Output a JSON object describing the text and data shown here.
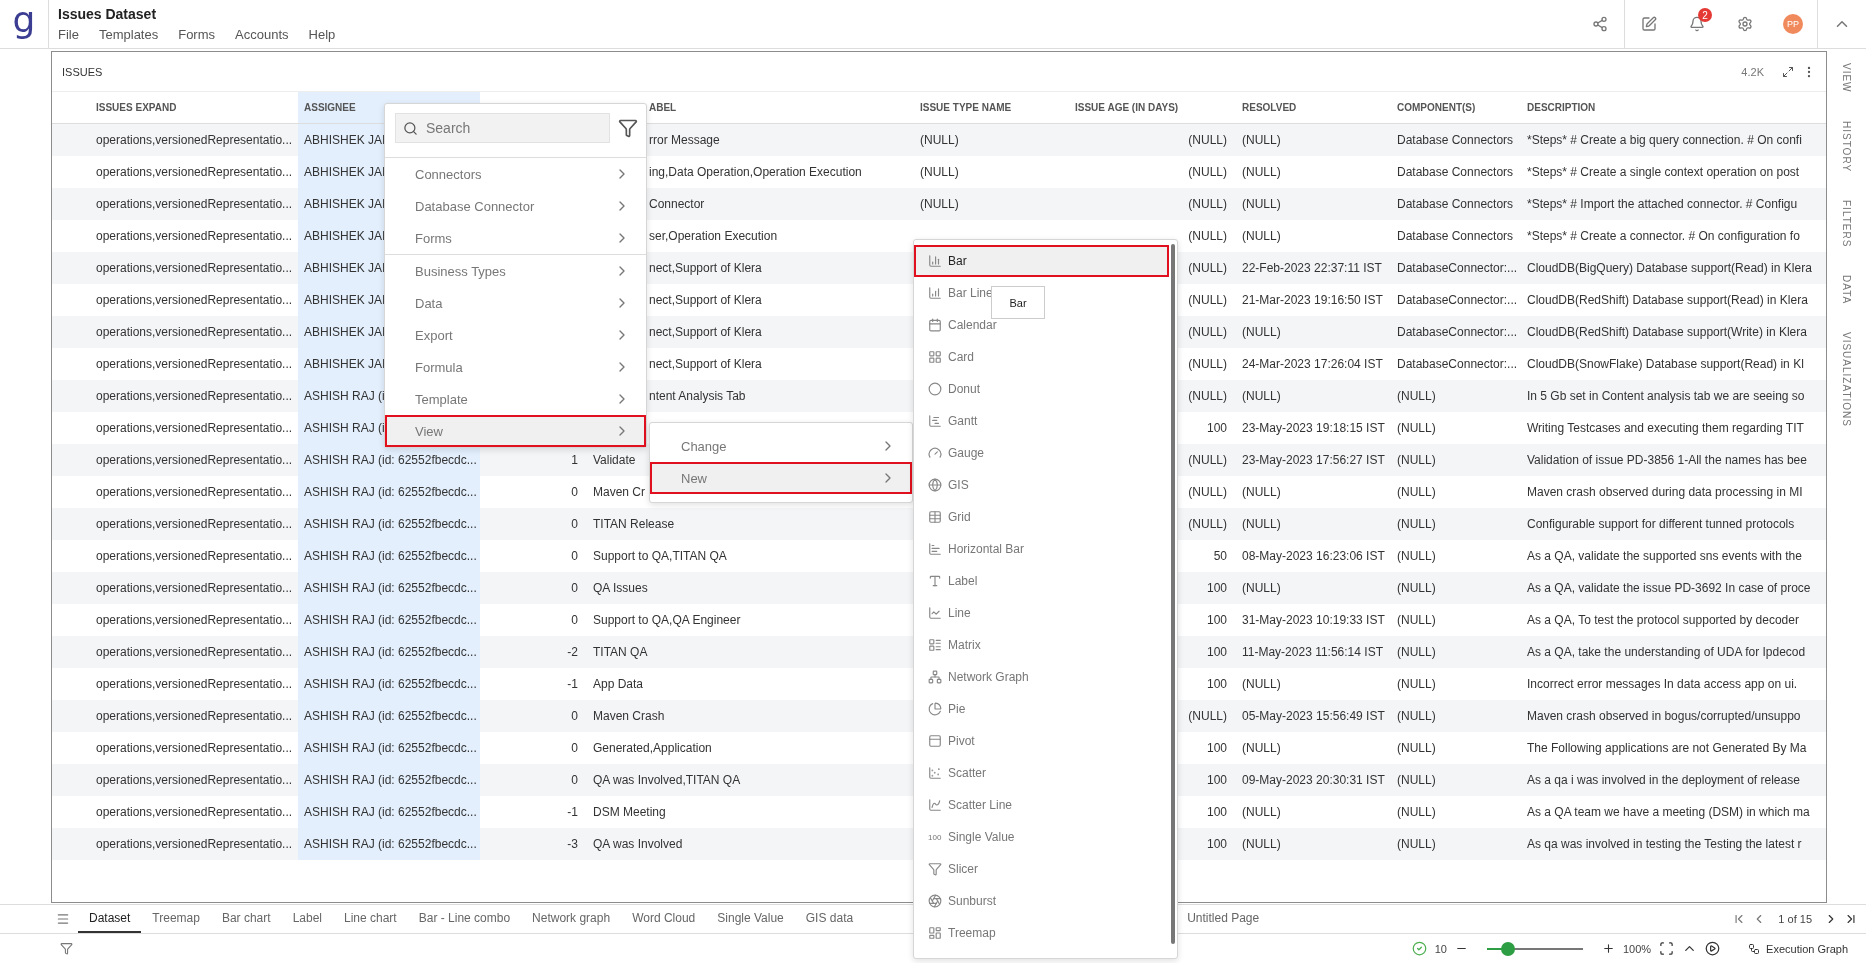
{
  "app": {
    "logo": "g",
    "title": "Issues Dataset",
    "menu": [
      "File",
      "Templates",
      "Forms",
      "Accounts",
      "Help"
    ],
    "notifications": "2",
    "avatar": "PP"
  },
  "panel": {
    "title": "ISSUES",
    "count": "4.2K"
  },
  "table": {
    "columns": [
      {
        "label": "ISSUES EXPAND"
      },
      {
        "label": "ASSIGNEE"
      },
      {
        "label_tail": "ABEL"
      },
      {
        "label": "ISSUE TYPE NAME"
      },
      {
        "label": "ISSUE AGE (IN DAYS)"
      },
      {
        "label": "RESOLVED"
      },
      {
        "label": "COMPONENT(S)"
      },
      {
        "label": "DESCRIPTION"
      }
    ],
    "rows": [
      {
        "issues_expand": "operations,versionedRepresentatio...",
        "assignee": "ABHISHEK JAI",
        "label_tail": "rror Message",
        "issue_type": "(NULL)",
        "age": "(NULL)",
        "resolved": "(NULL)",
        "components": "Database Connectors",
        "description": "*Steps* # Create a big query connection. # On confi"
      },
      {
        "issues_expand": "operations,versionedRepresentatio...",
        "assignee": "ABHISHEK JAI",
        "label_tail": "ing,Data Operation,Operation Execution",
        "issue_type": "(NULL)",
        "age": "(NULL)",
        "resolved": "(NULL)",
        "components": "Database Connectors",
        "description": "*Steps* # Create a single context operation on post"
      },
      {
        "issues_expand": "operations,versionedRepresentatio...",
        "assignee": "ABHISHEK JAI",
        "label_tail": "Connector",
        "issue_type": "(NULL)",
        "age": "(NULL)",
        "resolved": "(NULL)",
        "components": "Database Connectors",
        "description": "*Steps* # Import the attached connector. # Configu"
      },
      {
        "issues_expand": "operations,versionedRepresentatio...",
        "assignee": "ABHISHEK JAI",
        "label_tail": "ser,Operation Execution",
        "age": "(NULL)",
        "resolved": "(NULL)",
        "components": "Database Connectors",
        "description": "*Steps* # Create a connector. # On configuration fo"
      },
      {
        "issues_expand": "operations,versionedRepresentatio...",
        "assignee": "ABHISHEK JAI",
        "label_tail": "nect,Support of Klera",
        "age": "(NULL)",
        "resolved": "22-Feb-2023 22:37:11 IST",
        "components": "DatabaseConnector:...",
        "description": "CloudDB(BigQuery) Database support(Read) in Klera"
      },
      {
        "issues_expand": "operations,versionedRepresentatio...",
        "assignee": "ABHISHEK JAI",
        "label_tail": "nect,Support of Klera",
        "age": "(NULL)",
        "resolved": "21-Mar-2023 19:16:50 IST",
        "components": "DatabaseConnector:...",
        "description": "CloudDB(RedShift) Database support(Read) in Klera"
      },
      {
        "issues_expand": "operations,versionedRepresentatio...",
        "assignee": "ABHISHEK JAI",
        "label_tail": "nect,Support of Klera",
        "age": "(NULL)",
        "resolved": "(NULL)",
        "components": "DatabaseConnector:...",
        "description": "CloudDB(RedShift) Database support(Write) in Klera"
      },
      {
        "issues_expand": "operations,versionedRepresentatio...",
        "assignee": "ABHISHEK JAI",
        "label_tail": "nect,Support of Klera",
        "age": "(NULL)",
        "resolved": "24-Mar-2023 17:26:04 IST",
        "components": "DatabaseConnector:...",
        "description": "CloudDB(SnowFlake) Database support(Read) in Kl"
      },
      {
        "issues_expand": "operations,versionedRepresentatio...",
        "assignee": "ASHISH RAJ (i",
        "label_tail": "ntent Analysis Tab",
        "age": "(NULL)",
        "resolved": "(NULL)",
        "components": "(NULL)",
        "description": "In 5 Gb set in Content analysis tab we are seeing so"
      },
      {
        "issues_expand": "operations,versionedRepresentatio...",
        "assignee": "ASHISH RAJ (i",
        "age": "100",
        "resolved": "23-May-2023 19:18:15 IST",
        "components": "(NULL)",
        "description": "Writing Testcases and executing them regarding TIT"
      },
      {
        "issues_expand": "operations,versionedRepresentatio...",
        "assignee": "ASHISH RAJ (id: 62552fbecdc...",
        "number": "1",
        "label": "Validate",
        "age": "(NULL)",
        "resolved": "23-May-2023 17:56:27 IST",
        "components": "(NULL)",
        "description": "Validation of issue PD-3856 1-All the names has bee"
      },
      {
        "issues_expand": "operations,versionedRepresentatio...",
        "assignee": "ASHISH RAJ (id: 62552fbecdc...",
        "number": "0",
        "label": "Maven Cr",
        "age": "(NULL)",
        "resolved": "(NULL)",
        "components": "(NULL)",
        "description": "Maven crash observed during data processing in MI"
      },
      {
        "issues_expand": "operations,versionedRepresentatio...",
        "assignee": "ASHISH RAJ (id: 62552fbecdc...",
        "number": "0",
        "label": "TITAN Release",
        "age": "(NULL)",
        "resolved": "(NULL)",
        "components": "(NULL)",
        "description": "Configurable support for different tunned protocols"
      },
      {
        "issues_expand": "operations,versionedRepresentatio...",
        "assignee": "ASHISH RAJ (id: 62552fbecdc...",
        "number": "0",
        "label": "Support to QA,TITAN QA",
        "age": "50",
        "resolved": "08-May-2023 16:23:06 IST",
        "components": "(NULL)",
        "description": "As a QA, validate the supported sns events with the"
      },
      {
        "issues_expand": "operations,versionedRepresentatio...",
        "assignee": "ASHISH RAJ (id: 62552fbecdc...",
        "number": "0",
        "label": "QA Issues",
        "age": "100",
        "resolved": "(NULL)",
        "components": "(NULL)",
        "description": "As a QA, validate the issue PD-3692 In case of proce"
      },
      {
        "issues_expand": "operations,versionedRepresentatio...",
        "assignee": "ASHISH RAJ (id: 62552fbecdc...",
        "number": "0",
        "label": "Support to QA,QA Engineer",
        "age": "100",
        "resolved": "31-May-2023 10:19:33 IST",
        "components": "(NULL)",
        "description": "As a QA, To test the protocol supported by decoder"
      },
      {
        "issues_expand": "operations,versionedRepresentatio...",
        "assignee": "ASHISH RAJ (id: 62552fbecdc...",
        "number": "-2",
        "label": "TITAN QA",
        "age": "100",
        "resolved": "11-May-2023 11:56:14 IST",
        "components": "(NULL)",
        "description": "As a QA, take the understanding of UDA for Ipdecod"
      },
      {
        "issues_expand": "operations,versionedRepresentatio...",
        "assignee": "ASHISH RAJ (id: 62552fbecdc...",
        "number": "-1",
        "label": "App Data",
        "age": "100",
        "resolved": "(NULL)",
        "components": "(NULL)",
        "description": "Incorrect error messages In data access app on ui."
      },
      {
        "issues_expand": "operations,versionedRepresentatio...",
        "assignee": "ASHISH RAJ (id: 62552fbecdc...",
        "number": "0",
        "label": "Maven Crash",
        "age": "(NULL)",
        "resolved": "05-May-2023 15:56:49 IST",
        "components": "(NULL)",
        "description": "Maven crash observed in bogus/corrupted/unsuppo"
      },
      {
        "issues_expand": "operations,versionedRepresentatio...",
        "assignee": "ASHISH RAJ (id: 62552fbecdc...",
        "number": "0",
        "label": "Generated,Application",
        "age": "100",
        "resolved": "(NULL)",
        "components": "(NULL)",
        "description": "The Following applications are not Generated By Ma"
      },
      {
        "issues_expand": "operations,versionedRepresentatio...",
        "assignee": "ASHISH RAJ (id: 62552fbecdc...",
        "number": "0",
        "label": "QA was Involved,TITAN QA",
        "age": "100",
        "resolved": "09-May-2023 20:30:31 IST",
        "components": "(NULL)",
        "description": "As a qa i was involved in the deployment of release"
      },
      {
        "issues_expand": "operations,versionedRepresentatio...",
        "assignee": "ASHISH RAJ (id: 62552fbecdc...",
        "number": "-1",
        "label": "DSM Meeting",
        "age": "100",
        "resolved": "(NULL)",
        "components": "(NULL)",
        "description": "As a QA team we have a meeting (DSM) in which ma"
      },
      {
        "issues_expand": "operations,versionedRepresentatio...",
        "assignee": "ASHISH RAJ (id: 62552fbecdc...",
        "number": "-3",
        "label": "QA was Involved",
        "age": "100",
        "resolved": "(NULL)",
        "components": "(NULL)",
        "description": "As qa was involved in testing the Testing the latest r"
      }
    ]
  },
  "context_menu": {
    "search": {
      "placeholder": "Search"
    },
    "sections": [
      {
        "items": [
          {
            "label": "Connectors",
            "selected": false
          },
          {
            "label": "Database Connector",
            "selected": false
          },
          {
            "label": "Forms",
            "selected": false
          }
        ]
      },
      {
        "items": [
          {
            "label": "Business Types",
            "selected": false
          },
          {
            "label": "Data",
            "selected": false
          },
          {
            "label": "Export",
            "selected": false
          },
          {
            "label": "Formula",
            "selected": false
          },
          {
            "label": "Template",
            "selected": false
          },
          {
            "label": "View",
            "selected": true
          }
        ]
      }
    ]
  },
  "submenu": {
    "items": [
      {
        "label": "Change",
        "selected": false
      },
      {
        "label": "New",
        "selected": true
      }
    ]
  },
  "visualization_menu": {
    "tooltip": "Bar",
    "items": [
      {
        "label": "Bar",
        "selected": true
      },
      {
        "label": "Bar Line",
        "selected": false
      },
      {
        "label": "Calendar",
        "selected": false
      },
      {
        "label": "Card",
        "selected": false
      },
      {
        "label": "Donut",
        "selected": false
      },
      {
        "label": "Gantt",
        "selected": false
      },
      {
        "label": "Gauge",
        "selected": false
      },
      {
        "label": "GIS",
        "selected": false
      },
      {
        "label": "Grid",
        "selected": false
      },
      {
        "label": "Horizontal Bar",
        "selected": false
      },
      {
        "label": "Label",
        "selected": false
      },
      {
        "label": "Line",
        "selected": false
      },
      {
        "label": "Matrix",
        "selected": false
      },
      {
        "label": "Network Graph",
        "selected": false
      },
      {
        "label": "Pie",
        "selected": false
      },
      {
        "label": "Pivot",
        "selected": false
      },
      {
        "label": "Scatter",
        "selected": false
      },
      {
        "label": "Scatter Line",
        "selected": false
      },
      {
        "label": "Single Value",
        "selected": false,
        "icon_text": "100"
      },
      {
        "label": "Slicer",
        "selected": false
      },
      {
        "label": "Sunburst",
        "selected": false
      },
      {
        "label": "Treemap",
        "selected": false
      }
    ]
  },
  "side_panel": {
    "tabs": [
      "VIEW",
      "HISTORY",
      "FILTERS",
      "DATA",
      "VISUALIZATIONS"
    ]
  },
  "sheet_tabs": [
    {
      "label": "Dataset",
      "selected": true
    },
    {
      "label": "Treemap",
      "selected": false
    },
    {
      "label": "Bar chart",
      "selected": false
    },
    {
      "label": "Label",
      "selected": false
    },
    {
      "label": "Line chart",
      "selected": false
    },
    {
      "label": "Bar - Line combo",
      "selected": false
    },
    {
      "label": "Network graph",
      "selected": false
    },
    {
      "label": "Word Cloud",
      "selected": false
    },
    {
      "label": "Single Value",
      "selected": false
    },
    {
      "label": "GIS data",
      "selected": false
    }
  ],
  "trailing_tab": {
    "label": "Untitled Page"
  },
  "pagination": "1 of 15",
  "status_bar": {
    "count": "10",
    "zoom": {
      "level": 0.22,
      "reading": "100%"
    },
    "button": "Execution Graph"
  }
}
